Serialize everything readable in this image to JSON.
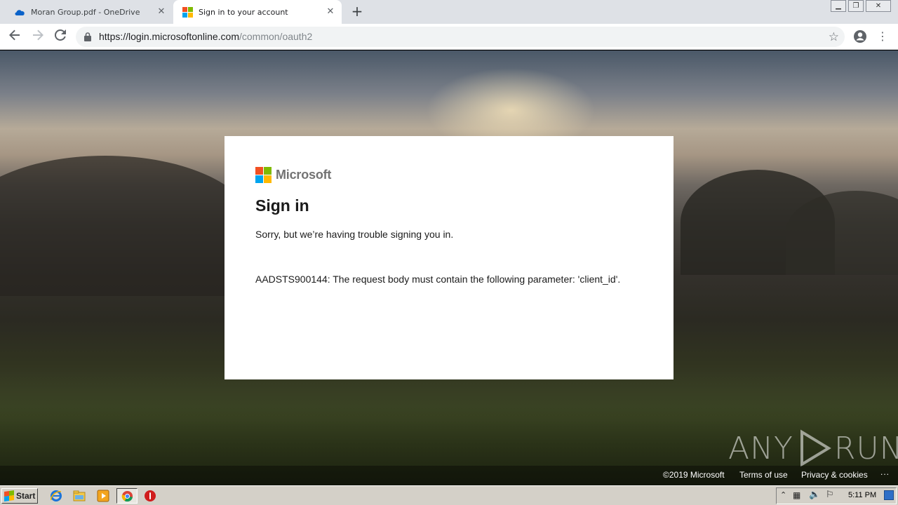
{
  "browser": {
    "tabs": [
      {
        "title": "Moran Group.pdf - OneDrive",
        "icon": "onedrive-cloud-icon",
        "active": false
      },
      {
        "title": "Sign in to your account",
        "icon": "microsoft-logo-icon",
        "active": true
      }
    ],
    "address": {
      "url_main": "https://login.microsoftonline.com",
      "url_path": "/common/oauth2"
    }
  },
  "signin": {
    "brand": "Microsoft",
    "heading": "Sign in",
    "message": "Sorry, but we’re having trouble signing you in.",
    "error": "AADSTS900144: The request body must contain the following parameter: 'client_id'."
  },
  "footer": {
    "copyright": "©2019 Microsoft",
    "terms": "Terms of use",
    "privacy": "Privacy & cookies",
    "more": "..."
  },
  "watermark": {
    "left": "ANY",
    "right": "RUN"
  },
  "taskbar": {
    "start_label": "Start",
    "clock": "5:11 PM"
  },
  "colors": {
    "ms_red": "#f25022",
    "ms_green": "#7fba00",
    "ms_blue": "#00a4ef",
    "ms_yellow": "#ffb900"
  }
}
